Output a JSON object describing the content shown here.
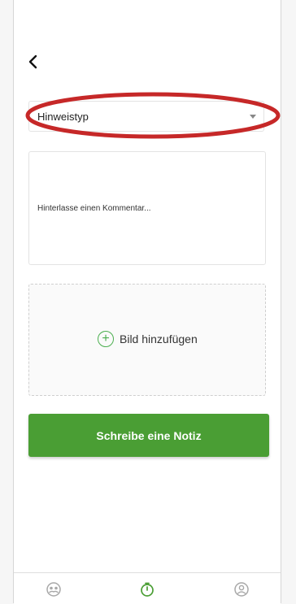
{
  "form": {
    "type_select": {
      "value": "Hinweistyp",
      "icon": "dropdown-caret-icon"
    },
    "comment": {
      "placeholder": "Hinterlasse einen Kommentar..."
    },
    "image_upload": {
      "label": "Bild hinzufügen",
      "icon": "plus-circle-icon"
    },
    "submit_label": "Schreibe eine Notiz"
  },
  "header": {
    "back_icon": "chevron-left-icon"
  },
  "bottom_nav": {
    "items": [
      {
        "icon": "community-icon"
      },
      {
        "icon": "timer-icon",
        "active": true
      },
      {
        "icon": "profile-icon"
      }
    ]
  },
  "colors": {
    "accent": "#4a9e34",
    "highlight": "#c62828",
    "inactive_icon": "#a8a8a8"
  }
}
